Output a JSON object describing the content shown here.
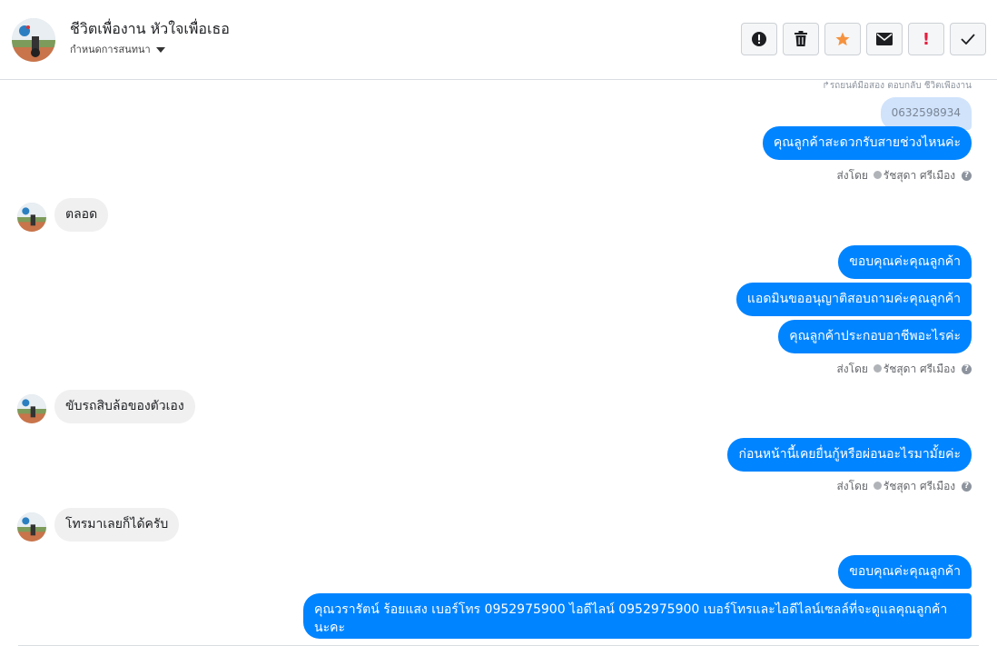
{
  "header": {
    "name": "ชีวิตเพื่องาน หัวใจเพื่อเธอ",
    "subtitle": "กำหนดการสนทนา",
    "actions": [
      {
        "id": "report",
        "icon": "alert-circle-icon"
      },
      {
        "id": "delete",
        "icon": "trash-icon"
      },
      {
        "id": "star",
        "icon": "star-icon",
        "color": "#f5923e"
      },
      {
        "id": "mail",
        "icon": "envelope-icon"
      },
      {
        "id": "important",
        "icon": "exclamation-icon",
        "label": "!",
        "color": "#e41e3f"
      },
      {
        "id": "done",
        "icon": "check-icon"
      }
    ]
  },
  "thread": {
    "forward_note": "รถยนต์มือสอง ตอบกลับ ชีวิตเพื่องาน",
    "quoted_text": "0632598934",
    "sent_by_label": "ส่งโดย",
    "agent_name": "รัชสุดา ศรีเมือง",
    "help_mark": "?",
    "messages": [
      {
        "dir": "out",
        "text": "คุณลูกค้าสะดวกรับสายช่วงไหนค่ะ"
      },
      {
        "dir": "in",
        "text": "ตลอด"
      },
      {
        "dir": "out",
        "text": "ขอบคุณค่ะคุณลูกค้า"
      },
      {
        "dir": "out",
        "text": "แอดมินขออนุญาติสอบถามค่ะคุณลูกค้า"
      },
      {
        "dir": "out",
        "text": "คุณลูกค้าประกอบอาชีพอะไรค่ะ"
      },
      {
        "dir": "in",
        "text": "ขับรถสิบล้อของตัวเอง"
      },
      {
        "dir": "out",
        "text": "ก่อนหน้านี้เคยยื่นกู้หรือผ่อนอะไรมามั้ยค่ะ"
      },
      {
        "dir": "in",
        "text": "โทรมาเลยก็ได้ครับ"
      },
      {
        "dir": "out",
        "text": "ขอบคุณค่ะคุณลูกค้า"
      },
      {
        "dir": "out",
        "text": "คุณวรารัตน์ ร้อยแสง       เบอร์โทร 0952975900  ไอดีไลน์ 0952975900   เบอร์โทรและไอดีไลน์เซลล์ที่จะดูแลคุณลูกค้านะคะ"
      }
    ]
  }
}
